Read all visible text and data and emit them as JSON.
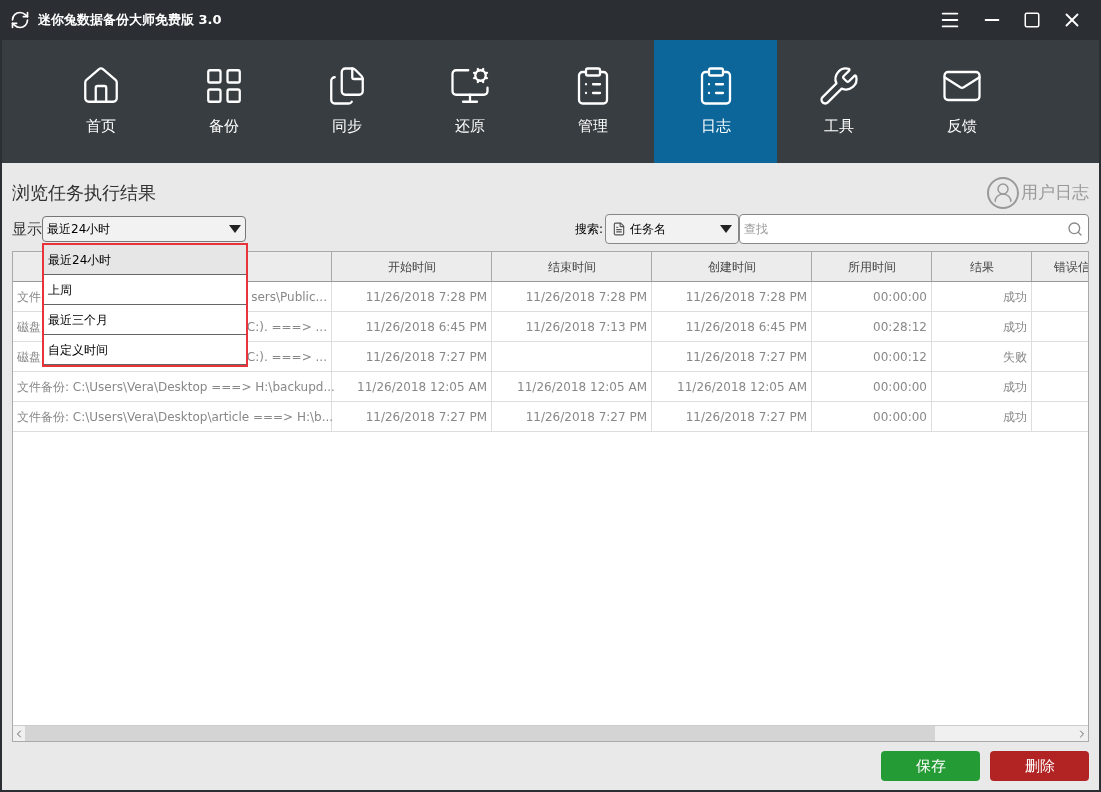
{
  "window": {
    "title": "迷你兔数据备份大师免费版 3.0"
  },
  "nav": [
    {
      "label": "首页",
      "selected": false
    },
    {
      "label": "备份",
      "selected": false
    },
    {
      "label": "同步",
      "selected": false
    },
    {
      "label": "还原",
      "selected": false
    },
    {
      "label": "管理",
      "selected": false
    },
    {
      "label": "日志",
      "selected": true
    },
    {
      "label": "工具",
      "selected": false
    },
    {
      "label": "反馈",
      "selected": false
    }
  ],
  "page_title": "浏览任务执行结果",
  "user_log": "用户日志",
  "filter": {
    "label": "显示",
    "value": "最近24小时",
    "expanded": true,
    "options": [
      {
        "label": "最近24小时",
        "selected": true
      },
      {
        "label": "上周",
        "selected": false
      },
      {
        "label": "最近三个月",
        "selected": false
      },
      {
        "label": "自定义时间",
        "selected": false
      }
    ]
  },
  "search": {
    "label": "搜索:",
    "field": "任务名",
    "placeholder": "查找"
  },
  "table": {
    "columns": [
      "",
      "开始时间",
      "结束时间",
      "创建时间",
      "所用时间",
      "结果",
      "错误信"
    ],
    "rows": [
      {
        "task": [
          "文件",
          "sers\\Public..."
        ],
        "start": "11/26/2018 7:28 PM",
        "end": "11/26/2018 7:28 PM",
        "created": "11/26/2018 7:28 PM",
        "duration": "00:00:00",
        "result": "成功"
      },
      {
        "task": [
          "磁盘",
          "C:). ===> ..."
        ],
        "start": "11/26/2018 6:45 PM",
        "end": "11/26/2018 7:13 PM",
        "created": "11/26/2018 6:45 PM",
        "duration": "00:28:12",
        "result": "成功"
      },
      {
        "task": [
          "磁盘",
          "C:). ===> ..."
        ],
        "start": "11/26/2018 7:27 PM",
        "end": "",
        "created": "11/26/2018 7:27 PM",
        "duration": "00:00:12",
        "result": "失败"
      },
      {
        "task": [
          "文件备份: C:\\Users\\Vera\\Desktop ===> H:\\backupd..."
        ],
        "start": "11/26/2018 12:05 AM",
        "end": "11/26/2018 12:05 AM",
        "created": "11/26/2018 12:05 AM",
        "duration": "00:00:00",
        "result": "成功"
      },
      {
        "task": [
          "文件备份: C:\\Users\\Vera\\Desktop\\article ===> H:\\b..."
        ],
        "start": "11/26/2018 7:27 PM",
        "end": "11/26/2018 7:27 PM",
        "created": "11/26/2018 7:27 PM",
        "duration": "00:00:00",
        "result": "成功"
      }
    ]
  },
  "buttons": [
    {
      "label": "保存",
      "kind": "save"
    },
    {
      "label": "删除",
      "kind": "delete"
    }
  ]
}
